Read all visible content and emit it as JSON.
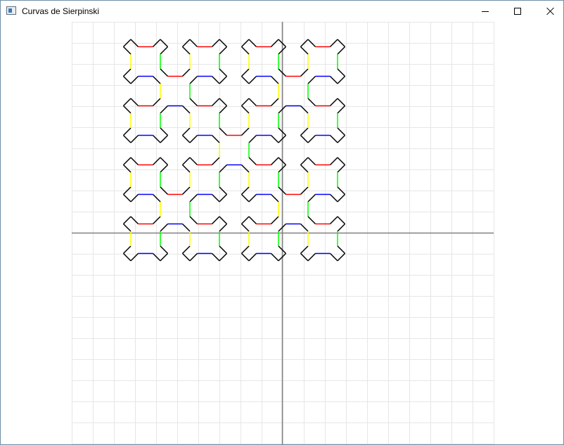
{
  "window": {
    "title": "Curvas de Sierpinski",
    "icon": "app-window-icon",
    "controls": [
      "minimize-icon",
      "maximize-icon",
      "close-icon"
    ]
  },
  "plot": {
    "type": "sierpinski-curve",
    "grid": true,
    "grid_color": "#e6e6e6",
    "axes_color": "#808080",
    "background": "#ffffff",
    "segment_colors": {
      "up-left": "#000000",
      "up": "#ffff00",
      "up-right": "#000000",
      "right": "#ff0000",
      "down-right": "#000000",
      "down": "#00ff00",
      "down-left": "#000000",
      "left": "#0000ff"
    },
    "level": 3
  }
}
